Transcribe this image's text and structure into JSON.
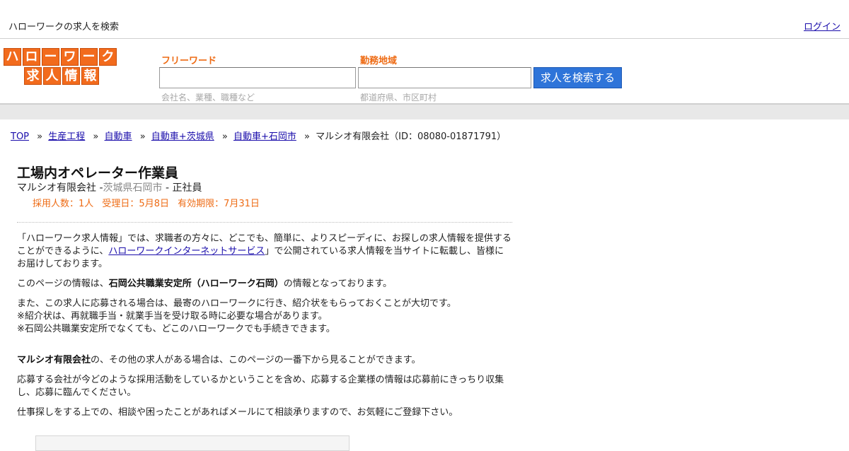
{
  "topbar": {
    "site_title": "ハローワークの求人を検索",
    "login": "ログイン"
  },
  "logo": {
    "row1": [
      "ハ",
      "ロ",
      "ー",
      "ワ",
      "ー",
      "ク"
    ],
    "row2": [
      "求",
      "人",
      "情",
      "報"
    ]
  },
  "search": {
    "freeword_label": "フリーワード",
    "freeword_value": "",
    "freeword_hint": "会社名、業種、職種など",
    "area_label": "勤務地域",
    "area_value": "",
    "area_hint": "都道府県、市区町村",
    "button_label": "求人を検索する"
  },
  "breadcrumb": {
    "top": "TOP",
    "sep": "»",
    "items": [
      "生産工程",
      "自動車",
      "自動車+茨城県",
      "自動車+石岡市"
    ],
    "current": "マルシオ有限会社（ID：08080-01871791）"
  },
  "job": {
    "title": "工場内オペレーター作業員",
    "company": "マルシオ有限会社",
    "dash1": "-",
    "location": "茨城県石岡市",
    "dash2": "-",
    "employment": "正社員",
    "hires": "採用人数：1人",
    "received": "受理日：5月8日",
    "expires": "有効期限：7月31日"
  },
  "content": {
    "p1_a": "「ハローワーク求人情報」では、求職者の方々に、どこでも、簡単に、よりスピーディに、お探しの求人情報を提供することができるように、",
    "p1_link": "ハローワークインターネットサービス",
    "p1_b": "」で公開されている求人情報を当サイトに転載し、皆様にお届けしております。",
    "p2_a": "このページの情報は、",
    "p2_bold": "石岡公共職業安定所（ハローワーク石岡）",
    "p2_b": "の情報となっております。",
    "p3_line1": "また、この求人に応募される場合は、最寄のハローワークに行き、紹介状をもらっておくことが大切です。",
    "p3_line2": "※紹介状は、再就職手当・就業手当を受け取る時に必要な場合があります。",
    "p3_line3": "※石岡公共職業安定所でなくても、どこのハローワークでも手続きできます。",
    "p4_bold": "マルシオ有限会社",
    "p4_text": "の、その他の求人がある場合は、このページの一番下から見ることができます。",
    "p5": "応募する会社が今どのような採用活動をしているかということを含め、応募する企業様の情報は応募前にきっちり収集し、応募に臨んでください。",
    "p6": "仕事探しをする上での、相談や困ったことがあればメールにて相談承りますので、お気軽にご登録下さい。"
  }
}
